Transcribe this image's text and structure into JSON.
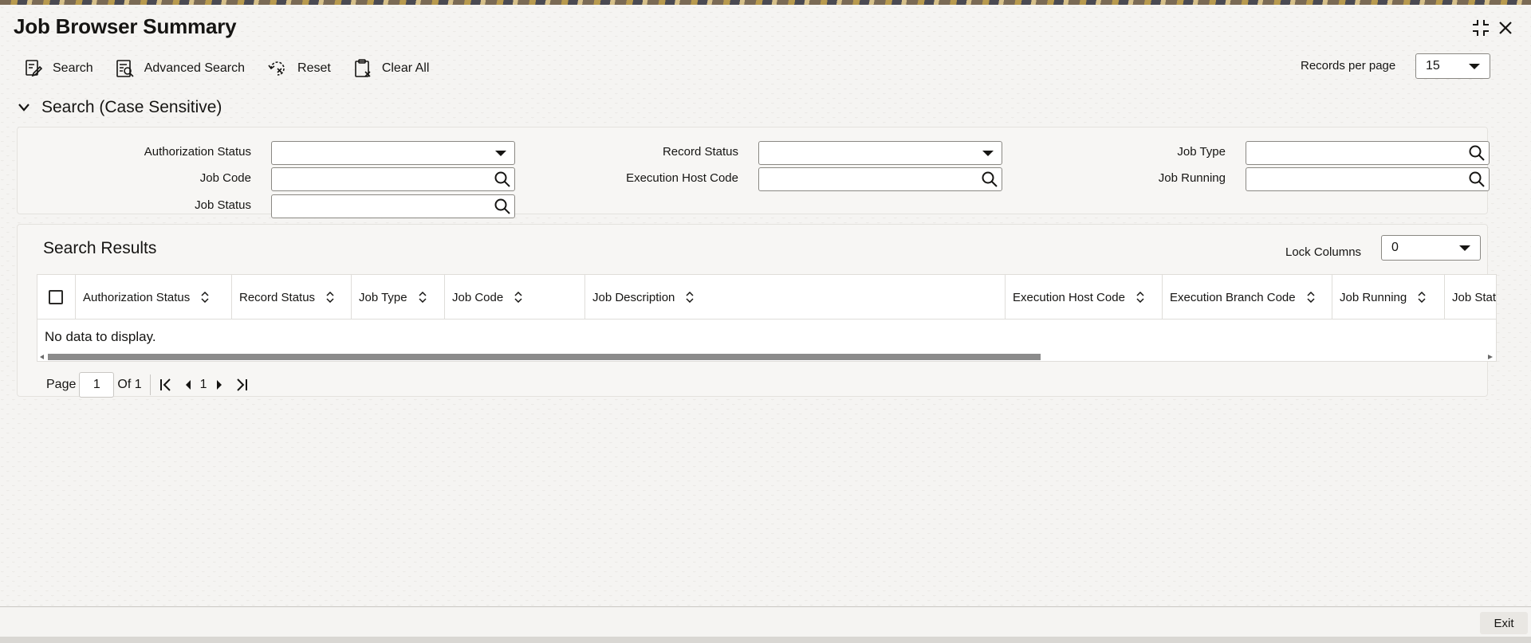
{
  "window": {
    "title": "Job Browser Summary"
  },
  "toolbar": {
    "search_label": "Search",
    "advanced_search_label": "Advanced Search",
    "reset_label": "Reset",
    "clear_all_label": "Clear All",
    "records_per_page_label": "Records per page",
    "records_per_page_value": "15"
  },
  "search_section": {
    "title": "Search (Case Sensitive)",
    "fields": {
      "authorization_status": {
        "label": "Authorization Status",
        "value": ""
      },
      "record_status": {
        "label": "Record Status",
        "value": ""
      },
      "job_type": {
        "label": "Job Type",
        "value": ""
      },
      "job_code": {
        "label": "Job Code",
        "value": ""
      },
      "execution_host_code": {
        "label": "Execution Host Code",
        "value": ""
      },
      "job_running": {
        "label": "Job Running",
        "value": ""
      },
      "job_status": {
        "label": "Job Status",
        "value": ""
      }
    }
  },
  "results": {
    "title": "Search Results",
    "lock_columns_label": "Lock Columns",
    "lock_columns_value": "0",
    "columns": [
      "Authorization Status",
      "Record Status",
      "Job Type",
      "Job Code",
      "Job Description",
      "Execution Host Code",
      "Execution Branch Code",
      "Job Running",
      "Job Stat"
    ],
    "empty_message": "No data to display."
  },
  "pagination": {
    "page_label": "Page",
    "current_page": "1",
    "of_label": "Of 1",
    "page_number": "1"
  },
  "footer": {
    "exit_label": "Exit"
  }
}
